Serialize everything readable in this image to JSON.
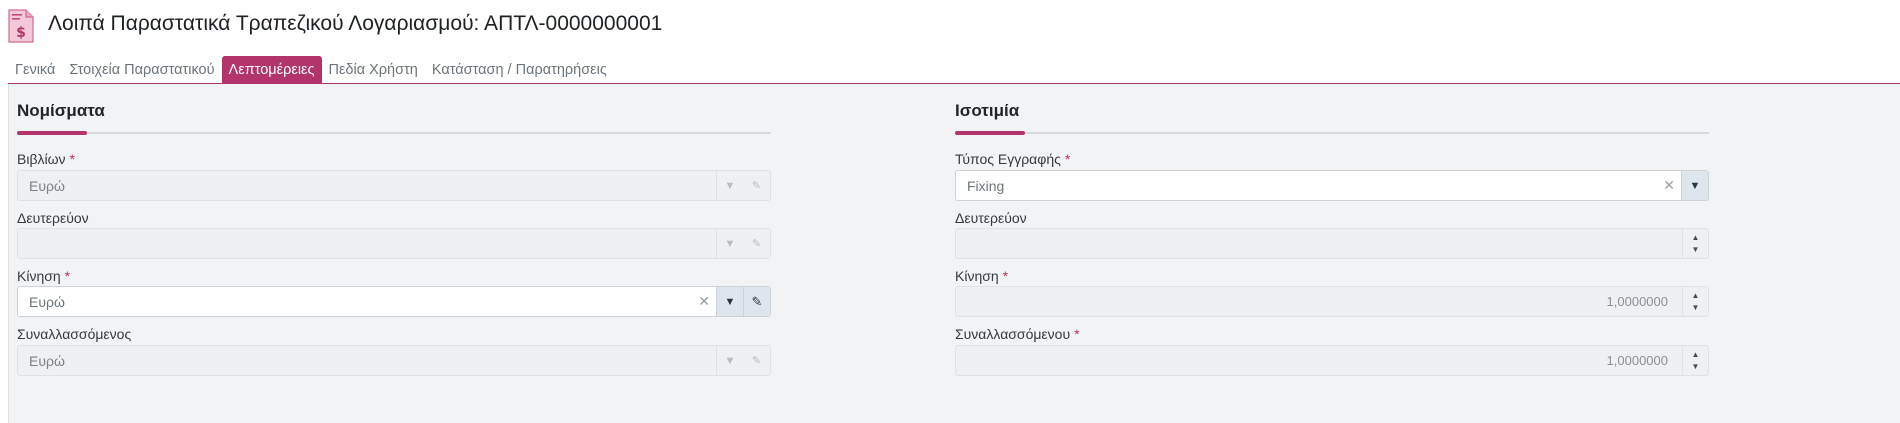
{
  "header": {
    "title": "Λοιπά Παραστατικά Τραπεζικού Λογαριασμού: ΑΠΤΛ-0000000001"
  },
  "tabs": [
    {
      "label": "Γενικά",
      "active": false
    },
    {
      "label": "Στοιχεία Παραστατικού",
      "active": false
    },
    {
      "label": "Λεπτομέρειες",
      "active": true
    },
    {
      "label": "Πεδία Χρήστη",
      "active": false
    },
    {
      "label": "Κατάσταση / Παρατηρήσεις",
      "active": false
    }
  ],
  "currencies": {
    "title": "Νομίσματα",
    "books": {
      "label": "Βιβλίων",
      "required": "*",
      "value": "Ευρώ"
    },
    "secondary": {
      "label": "Δευτερεύον",
      "value": ""
    },
    "movement": {
      "label": "Κίνηση",
      "required": "*",
      "value": "Ευρώ"
    },
    "counterparty": {
      "label": "Συναλλασσόμενος",
      "value": "Ευρώ"
    }
  },
  "parity": {
    "title": "Ισοτιμία",
    "entry_type": {
      "label": "Τύπος Εγγραφής",
      "required": "*",
      "value": "Fixing"
    },
    "secondary": {
      "label": "Δευτερεύον",
      "value": ""
    },
    "movement": {
      "label": "Κίνηση",
      "required": "*",
      "value": "1,0000000"
    },
    "counterparty": {
      "label": "Συναλλασσόμενου",
      "required": "*",
      "value": "1,0000000"
    }
  },
  "colors": {
    "accent": "#b3336b",
    "panel_bg": "#f1f3f5",
    "disabled_input_bg": "#eef0f2"
  }
}
